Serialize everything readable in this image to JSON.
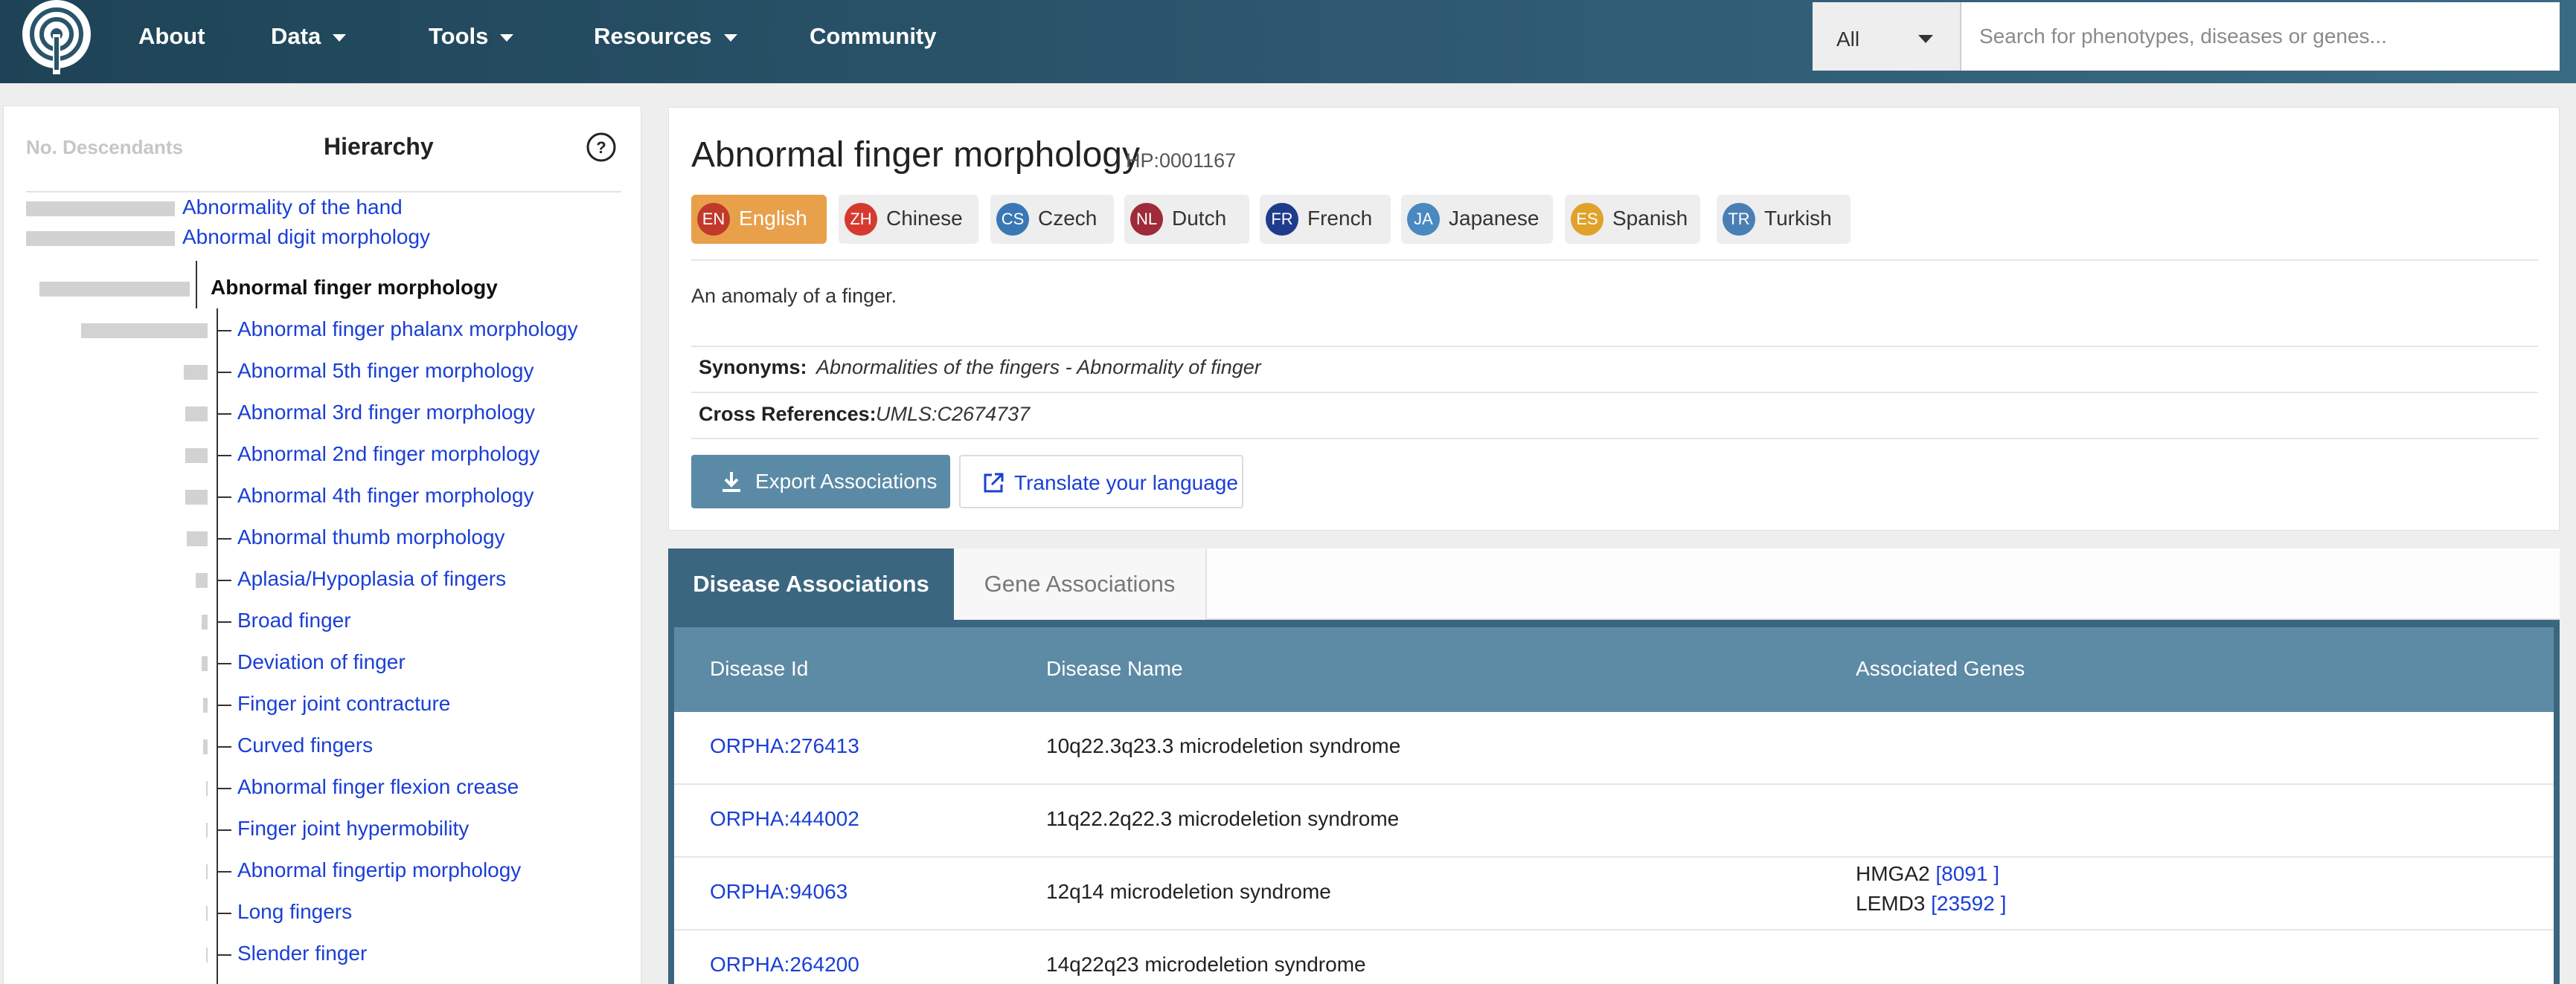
{
  "nav": {
    "items": [
      {
        "label": "About",
        "dropdown": false
      },
      {
        "label": "Data",
        "dropdown": true
      },
      {
        "label": "Tools",
        "dropdown": true
      },
      {
        "label": "Resources",
        "dropdown": true
      },
      {
        "label": "Community",
        "dropdown": false
      }
    ],
    "search": {
      "category": "All",
      "placeholder": "Search for phenotypes, diseases or genes..."
    }
  },
  "hierarchy": {
    "descendants_label": "No. Descendants",
    "title": "Hierarchy",
    "parents": [
      {
        "label": "Abnormality of the hand"
      },
      {
        "label": "Abnormal digit morphology"
      }
    ],
    "current": "Abnormal finger morphology",
    "children": [
      {
        "label": "Abnormal finger phalanx morphology"
      },
      {
        "label": "Abnormal 5th finger morphology"
      },
      {
        "label": "Abnormal 3rd finger morphology"
      },
      {
        "label": "Abnormal 2nd finger morphology"
      },
      {
        "label": "Abnormal 4th finger morphology"
      },
      {
        "label": "Abnormal thumb morphology"
      },
      {
        "label": "Aplasia/Hypoplasia of fingers"
      },
      {
        "label": "Broad finger"
      },
      {
        "label": "Deviation of finger"
      },
      {
        "label": "Finger joint contracture"
      },
      {
        "label": "Curved fingers"
      },
      {
        "label": "Abnormal finger flexion crease"
      },
      {
        "label": "Finger joint hypermobility"
      },
      {
        "label": "Abnormal fingertip morphology"
      },
      {
        "label": "Long fingers"
      },
      {
        "label": "Slender finger"
      }
    ]
  },
  "term": {
    "title": "Abnormal finger morphology",
    "id": "HP:0001167",
    "languages": [
      {
        "code": "EN",
        "name": "English",
        "color": "#c0392b",
        "active": true
      },
      {
        "code": "ZH",
        "name": "Chinese",
        "color": "#d63a2f",
        "active": false
      },
      {
        "code": "CS",
        "name": "Czech",
        "color": "#3a78b5",
        "active": false
      },
      {
        "code": "NL",
        "name": "Dutch",
        "color": "#9e2a3a",
        "active": false
      },
      {
        "code": "FR",
        "name": "French",
        "color": "#1f3c8c",
        "active": false
      },
      {
        "code": "JA",
        "name": "Japanese",
        "color": "#4a88c0",
        "active": false
      },
      {
        "code": "ES",
        "name": "Spanish",
        "color": "#e0a22a",
        "active": false
      },
      {
        "code": "TR",
        "name": "Turkish",
        "color": "#4a7fb5",
        "active": false
      }
    ],
    "definition": "An anomaly of a finger.",
    "synonyms_label": "Synonyms:",
    "synonyms": "Abnormalities of the fingers - Abnormality of finger",
    "xrefs_label": "Cross References:",
    "xrefs": "UMLS:C2674737",
    "export_label": "Export Associations",
    "translate_label": "Translate your language"
  },
  "associations": {
    "tabs": [
      {
        "label": "Disease Associations",
        "active": true
      },
      {
        "label": "Gene Associations",
        "active": false
      }
    ],
    "columns": [
      "Disease Id",
      "Disease Name",
      "Associated Genes"
    ],
    "rows": [
      {
        "id": "ORPHA:276413",
        "name": "10q22.3q23.3 microdeletion syndrome",
        "genes": []
      },
      {
        "id": "ORPHA:444002",
        "name": "11q22.2q22.3 microdeletion syndrome",
        "genes": []
      },
      {
        "id": "ORPHA:94063",
        "name": "12q14 microdeletion syndrome",
        "genes": [
          {
            "symbol": "HMGA2",
            "ref": "[8091 ]"
          },
          {
            "symbol": "LEMD3",
            "ref": "[23592 ]"
          }
        ]
      },
      {
        "id": "ORPHA:264200",
        "name": "14q22q23 microdeletion syndrome",
        "genes": []
      }
    ]
  }
}
